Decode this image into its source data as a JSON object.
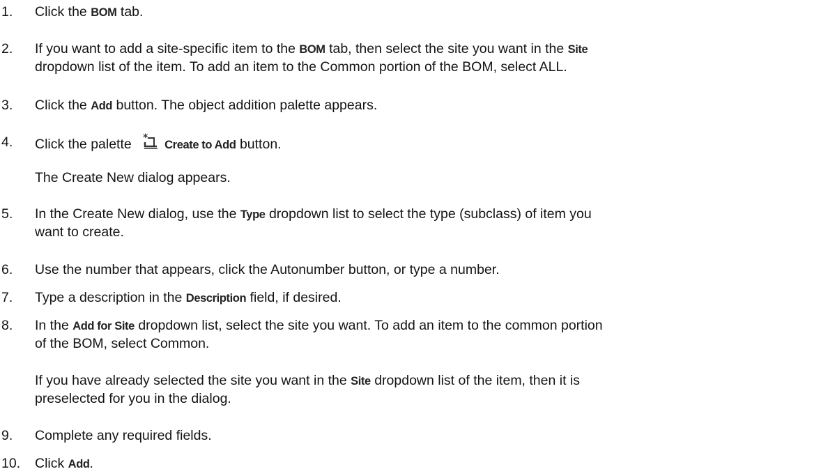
{
  "steps": [
    {
      "num": "1.",
      "lines": [
        {
          "parts": [
            "Click the ",
            "BOM",
            " tab."
          ]
        }
      ]
    },
    {
      "num": "2.",
      "lines": [
        {
          "parts": [
            "If you want to add a site-specific item to the ",
            "BOM",
            " tab, then select the site you want in the ",
            "Site"
          ]
        },
        {
          "parts": [
            "dropdown list of the item. To add an item to the Common portion of the BOM, select ALL."
          ]
        }
      ]
    },
    {
      "num": "3.",
      "lines": [
        {
          "parts": [
            "Click the ",
            "Add",
            " button. The object addition palette appears."
          ]
        }
      ]
    },
    {
      "num": "4.",
      "lines": [
        {
          "parts": [
            "Click the palette ",
            "Create to Add",
            " button."
          ]
        }
      ],
      "note": "The Create New dialog appears."
    },
    {
      "num": "5.",
      "lines": [
        {
          "parts": [
            "In the Create New dialog, use the ",
            "Type",
            " dropdown list to select the type (subclass) of item you"
          ]
        },
        {
          "parts": [
            "want to create."
          ]
        }
      ]
    },
    {
      "num": "6.",
      "lines": [
        {
          "parts": [
            "Use the number that appears, click the Autonumber button, or type a number."
          ]
        }
      ]
    },
    {
      "num": "7.",
      "lines": [
        {
          "parts": [
            "Type a description in the ",
            "Description",
            " field, if desired."
          ]
        }
      ]
    },
    {
      "num": "8.",
      "lines": [
        {
          "parts": [
            "In the ",
            "Add for Site",
            " dropdown list, select the site you want. To add an item to the common portion"
          ]
        },
        {
          "parts": [
            "of the BOM, select Common."
          ]
        }
      ],
      "note_lines": [
        {
          "parts": [
            "If you have already selected the site you want in the ",
            "Site",
            " dropdown list of the item, then it is"
          ]
        },
        {
          "parts": [
            "preselected for you in the dialog."
          ]
        }
      ]
    },
    {
      "num": "9.",
      "lines": [
        {
          "parts": [
            "Complete any required fields."
          ]
        }
      ]
    },
    {
      "num": "10.",
      "lines": [
        {
          "parts": [
            "Click ",
            "Add",
            "."
          ]
        }
      ]
    }
  ],
  "icons": {
    "create_to_add": "new-item-icon"
  }
}
